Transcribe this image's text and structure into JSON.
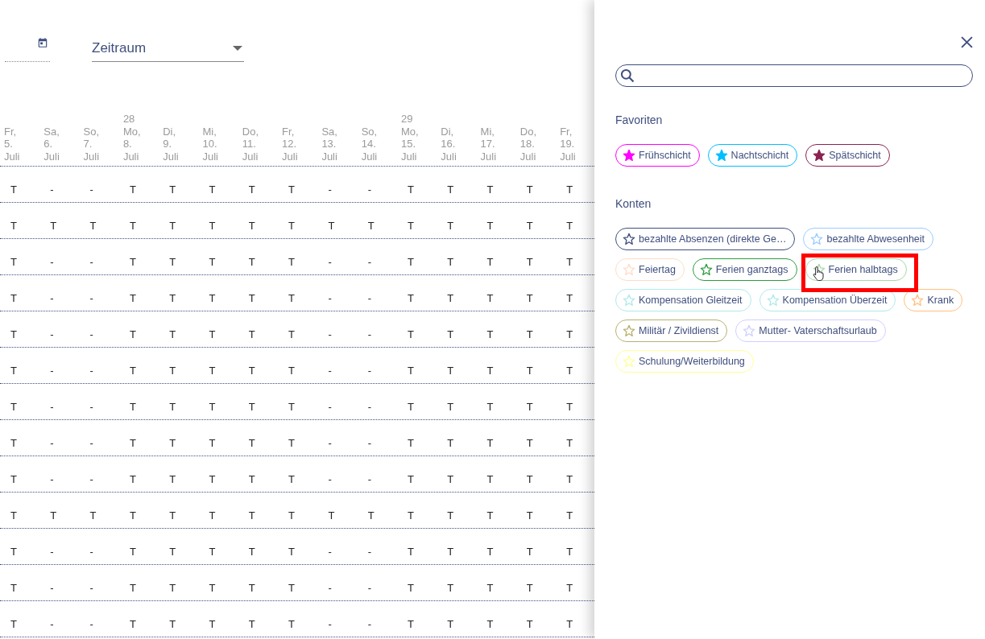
{
  "toolbar": {
    "period_select": {
      "value": "Zeitraum"
    }
  },
  "calendar": {
    "columns": [
      {
        "label": "Fr, 5. Juli"
      },
      {
        "label": "Sa, 6. Juli"
      },
      {
        "label": "So, 7. Juli"
      },
      {
        "week": "28",
        "label": "Mo, 8. Juli"
      },
      {
        "label": "Di, 9. Juli"
      },
      {
        "label": "Mi, 10. Juli"
      },
      {
        "label": "Do, 11. Juli"
      },
      {
        "label": "Fr, 12. Juli"
      },
      {
        "label": "Sa, 13. Juli"
      },
      {
        "label": "So, 14. Juli"
      },
      {
        "week": "29",
        "label": "Mo, 15. Juli"
      },
      {
        "label": "Di, 16. Juli"
      },
      {
        "label": "Mi, 17. Juli"
      },
      {
        "label": "Do, 18. Juli"
      },
      {
        "label": "Fr, 19. Juli"
      }
    ],
    "rows": [
      [
        "T",
        "-",
        "-",
        "T",
        "T",
        "T",
        "T",
        "T",
        "-",
        "-",
        "T",
        "T",
        "T",
        "T",
        "T"
      ],
      [
        "T",
        "T",
        "T",
        "T",
        "T",
        "T",
        "T",
        "T",
        "T",
        "T",
        "T",
        "T",
        "T",
        "T",
        "T"
      ],
      [
        "T",
        "-",
        "-",
        "T",
        "T",
        "T",
        "T",
        "T",
        "-",
        "-",
        "T",
        "T",
        "T",
        "T",
        "T"
      ],
      [
        "T",
        "-",
        "-",
        "T",
        "T",
        "T",
        "T",
        "T",
        "-",
        "-",
        "T",
        "T",
        "T",
        "T",
        "T"
      ],
      [
        "T",
        "-",
        "-",
        "T",
        "T",
        "T",
        "T",
        "T",
        "-",
        "-",
        "T",
        "T",
        "T",
        "T",
        "T"
      ],
      [
        "T",
        "-",
        "-",
        "T",
        "T",
        "T",
        "T",
        "T",
        "-",
        "-",
        "T",
        "T",
        "T",
        "T",
        "T"
      ],
      [
        "T",
        "-",
        "-",
        "T",
        "T",
        "T",
        "T",
        "T",
        "-",
        "-",
        "T",
        "T",
        "T",
        "T",
        "T"
      ],
      [
        "T",
        "-",
        "-",
        "T",
        "T",
        "T",
        "T",
        "T",
        "-",
        "-",
        "T",
        "T",
        "T",
        "T",
        "T"
      ],
      [
        "T",
        "-",
        "-",
        "T",
        "T",
        "T",
        "T",
        "T",
        "-",
        "-",
        "T",
        "T",
        "T",
        "T",
        "T"
      ],
      [
        "T",
        "T",
        "T",
        "T",
        "T",
        "T",
        "T",
        "T",
        "T",
        "T",
        "T",
        "T",
        "T",
        "T",
        "T"
      ],
      [
        "T",
        "-",
        "-",
        "T",
        "T",
        "T",
        "T",
        "T",
        "-",
        "-",
        "T",
        "T",
        "T",
        "T",
        "T"
      ],
      [
        "T",
        "-",
        "-",
        "T",
        "T",
        "T",
        "T",
        "T",
        "-",
        "-",
        "T",
        "T",
        "T",
        "T",
        "T"
      ],
      [
        "T",
        "-",
        "-",
        "T",
        "T",
        "T",
        "T",
        "T",
        "-",
        "-",
        "T",
        "T",
        "T",
        "T",
        "T"
      ]
    ]
  },
  "drawer": {
    "sections": [
      {
        "title": "Favoriten",
        "chips": [
          {
            "label": "Frühschicht",
            "color": "#ff00ff",
            "filled": true,
            "highlighted": false
          },
          {
            "label": "Nachtschicht",
            "color": "#00bfff",
            "filled": true,
            "highlighted": false
          },
          {
            "label": "Spätschicht",
            "color": "#8b2252",
            "filled": true,
            "highlighted": false
          }
        ]
      },
      {
        "title": "Konten",
        "chips": [
          {
            "label": "bezahlte Absenzen (direkte Ge…",
            "color": "#3f4f7f",
            "filled": false,
            "highlighted": false
          },
          {
            "label": "bezahlte Abwesenheit",
            "color": "#99ccff",
            "filled": false,
            "highlighted": false
          },
          {
            "label": "Feiertag",
            "color": "#ffdcc8",
            "filled": false,
            "highlighted": false
          },
          {
            "label": "Ferien ganztags",
            "color": "#2e9e3e",
            "filled": false,
            "highlighted": false
          },
          {
            "label": "Ferien halbtags",
            "color": "#a8d8a8",
            "filled": false,
            "highlighted": true
          },
          {
            "label": "Kompensation Gleitzeit",
            "color": "#b0eaea",
            "filled": false,
            "highlighted": false
          },
          {
            "label": "Kompensation Überzeit",
            "color": "#b0eaea",
            "filled": false,
            "highlighted": false
          },
          {
            "label": "Krank",
            "color": "#ffc080",
            "filled": false,
            "highlighted": false
          },
          {
            "label": "Militär / Zivildienst",
            "color": "#b8b070",
            "filled": false,
            "highlighted": false
          },
          {
            "label": "Mutter- Vaterschaftsurlaub",
            "color": "#d0d0ff",
            "filled": false,
            "highlighted": false
          },
          {
            "label": "Schulung/Weiterbildung",
            "color": "#ffff99",
            "filled": false,
            "highlighted": false
          }
        ]
      }
    ]
  }
}
